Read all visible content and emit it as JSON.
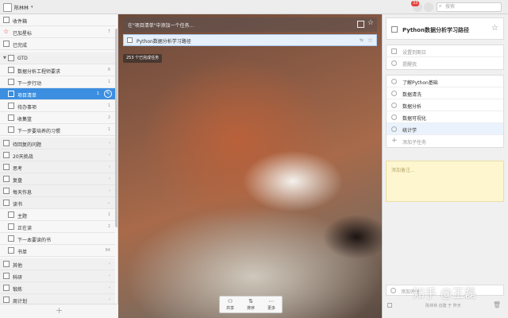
{
  "topbar": {
    "user_name": "陈林林",
    "badge": "33",
    "search_placeholder": "搜索"
  },
  "sidebar": {
    "items": [
      {
        "label": "收件箱",
        "count": ""
      },
      {
        "label": "已加星标",
        "count": "7"
      },
      {
        "label": "已完成",
        "count": ""
      },
      {
        "label": "GTD",
        "count": ""
      },
      {
        "label": "数据分析工程师要求",
        "count": "8"
      },
      {
        "label": "下一步行动",
        "count": "1"
      },
      {
        "label": "项目清单",
        "count": "1"
      },
      {
        "label": "待办事项",
        "count": "1"
      },
      {
        "label": "收集篮",
        "count": "2"
      },
      {
        "label": "下一步要培养的习惯",
        "count": "1"
      },
      {
        "label": "待回复的问题",
        "count": ""
      },
      {
        "label": "20天挑战",
        "count": ""
      },
      {
        "label": "思考",
        "count": ""
      },
      {
        "label": "复盘",
        "count": ""
      },
      {
        "label": "每天作息",
        "count": ""
      },
      {
        "label": "读书",
        "count": ""
      },
      {
        "label": "主题",
        "count": "1"
      },
      {
        "label": "正在读",
        "count": "2"
      },
      {
        "label": "下一本要读的书",
        "count": ""
      },
      {
        "label": "书单",
        "count": "84"
      },
      {
        "label": "其他",
        "count": ""
      },
      {
        "label": "科研",
        "count": ""
      },
      {
        "label": "锻炼",
        "count": ""
      },
      {
        "label": "周计划",
        "count": ""
      }
    ]
  },
  "main": {
    "add_placeholder": "在\"项目清单\"中添加一个任务...",
    "task_title": "Python数据分析学习路径",
    "completed_label": "253 个已完成任务",
    "toolbar": [
      {
        "label": "共享",
        "icon": "share-icon"
      },
      {
        "label": "排序",
        "icon": "sort-icon"
      },
      {
        "label": "更多",
        "icon": "more-icon"
      }
    ]
  },
  "detail": {
    "title": "Python数据分析学习路径",
    "due_label": "设置到期日",
    "reminder_label": "提醒我",
    "subtasks": [
      "了解Python基础",
      "数据清洗",
      "数据分析",
      "数据可视化",
      "统计学"
    ],
    "add_subtask": "添加子任务",
    "note_placeholder": "添加备注...",
    "comment_placeholder": "添加评论",
    "footer": "陈林林 创建 于 昨天"
  },
  "watermark": "知乎 @王磊"
}
